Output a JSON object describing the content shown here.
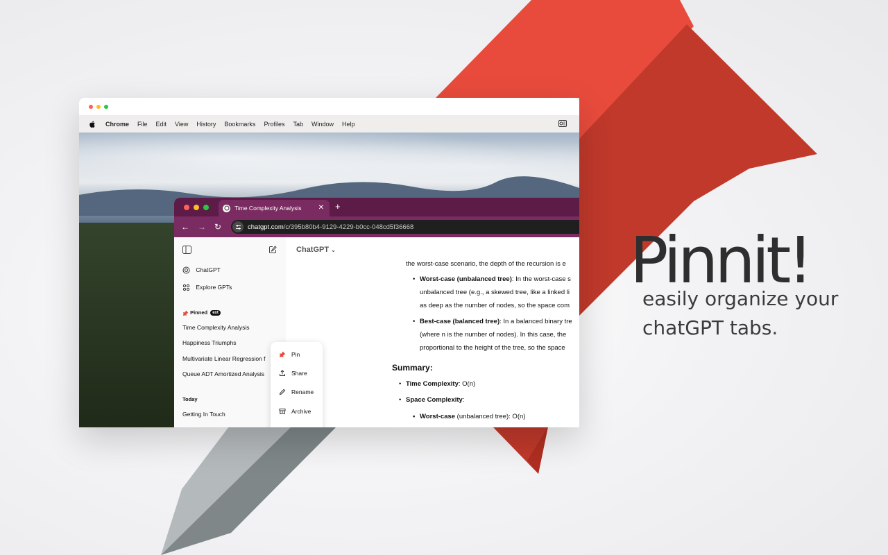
{
  "hero": {
    "headline": "Pinnit!",
    "tagline_line1": "easily organize your",
    "tagline_line2": "chatGPT tabs."
  },
  "colors": {
    "pin_red": "#e84b3c",
    "pin_dark_red": "#c0392b",
    "needle_gray": "#8a9193",
    "tab_purple": "#7a2b61",
    "tabbar_purple": "#5d1b47"
  },
  "mac_menubar": {
    "items": [
      "Chrome",
      "File",
      "Edit",
      "View",
      "History",
      "Bookmarks",
      "Profiles",
      "Tab",
      "Window",
      "Help"
    ]
  },
  "browser": {
    "tab_title": "Time Complexity Analysis",
    "url_host": "chatgpt.com",
    "url_path": "/c/395b80b4-9129-4229-b0cc-048cd5f36668"
  },
  "sidebar": {
    "chatgpt_label": "ChatGPT",
    "explore_label": "Explore GPTs",
    "pinned_label": "Pinned",
    "pinned_badge": "ext",
    "pinned_items": [
      "Time Complexity Analysis",
      "Happiness Triumphs",
      "Multivariate Linear Regression f",
      "Queue ADT Amortized Analysis"
    ],
    "today_label": "Today",
    "today_items": [
      "Getting In Touch"
    ]
  },
  "main": {
    "model_name": "ChatGPT",
    "line_top": "the worst-case scenario, the depth of the recursion is e",
    "b1_bold": "Worst-case (unbalanced tree)",
    "b1_rest": ": In the worst-case s",
    "b1_line2": "unbalanced tree (e.g., a skewed tree, like a linked li",
    "b1_line3": "as deep as the number of nodes, so the space com",
    "b2_bold": "Best-case (balanced tree)",
    "b2_rest": ": In a balanced binary tre",
    "b2_line2": "(where n is the number of nodes). In this case, the",
    "b2_line3": "proportional to the height of the tree, so the space",
    "summary_heading": "Summary:",
    "s1_bold": "Time Complexity",
    "s1_rest": ": O(n)",
    "s2_bold": "Space Complexity",
    "s2_rest": ":",
    "s3_bold": "Worst-case",
    "s3_rest": " (unbalanced tree): O(n)"
  },
  "context_menu": {
    "items": [
      "Pin",
      "Share",
      "Rename",
      "Archive"
    ]
  }
}
